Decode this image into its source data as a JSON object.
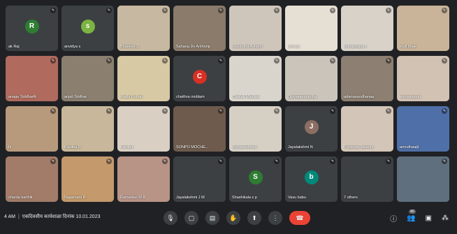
{
  "meeting": {
    "time": "4 AM",
    "title": "एकदिवसीय कार्यशाळा दिनांक 10.01.2023",
    "participants_badge": "40"
  },
  "tiles": [
    {
      "name": "ak Raj",
      "avatar": "R",
      "avatar_color": "#2e7d32",
      "bg": "#3c4043"
    },
    {
      "name": "anvidya s",
      "avatar": "s",
      "avatar_color": "#7cb342",
      "bg": "#3c4043"
    },
    {
      "name": "Bhavesh Ji",
      "avatar": "",
      "avatar_color": "",
      "bg": "#c7b8a1"
    },
    {
      "name": "Sahana Jiv Anthonp",
      "avatar": "",
      "avatar_color": "",
      "bg": "#8a7b6a"
    },
    {
      "name": "Vasundha Ashokh",
      "avatar": "",
      "avatar_color": "",
      "bg": "#cfc6bb"
    },
    {
      "name": "amruta",
      "avatar": "",
      "avatar_color": "",
      "bg": "#e6dfd4"
    },
    {
      "name": "soloaplolputh",
      "avatar": "",
      "avatar_color": "",
      "bg": "#d8d2c8"
    },
    {
      "name": "sruti bhak",
      "avatar": "",
      "avatar_color": "",
      "bg": "#c9b49a"
    },
    {
      "name": "anage Siddharth",
      "avatar": "",
      "avatar_color": "",
      "bg": "#b06a5e"
    },
    {
      "name": "anjali Sridhar",
      "avatar": "",
      "avatar_color": "",
      "bg": "#8b7f6f"
    },
    {
      "name": "Arathi Rohan",
      "avatar": "",
      "avatar_color": "",
      "bg": "#d8c9a5"
    },
    {
      "name": "chaithra moblam",
      "avatar": "C",
      "avatar_color": "#d93025",
      "bg": "#3c4043"
    },
    {
      "name": "Chaitali Manikar",
      "avatar": "",
      "avatar_color": "",
      "bg": "#d9d4cc"
    },
    {
      "name": "Divyaseemantha",
      "avatar": "",
      "avatar_color": "",
      "bg": "#cbc4ba"
    },
    {
      "name": "adamaraodhanaa",
      "avatar": "",
      "avatar_color": "",
      "bg": "#8d7f71"
    },
    {
      "name": "enmakasturi",
      "avatar": "",
      "avatar_color": "",
      "bg": "#d2c2b3"
    },
    {
      "name": "hi",
      "avatar": "",
      "avatar_color": "",
      "bg": "#b79a7c"
    },
    {
      "name": "Kavitha R",
      "avatar": "",
      "avatar_color": "",
      "bg": "#c8b79b"
    },
    {
      "name": "Kavitha",
      "avatar": "",
      "avatar_color": "",
      "bg": "#d9cfc3"
    },
    {
      "name": "SONPO MOCHE...",
      "avatar": "",
      "avatar_color": "",
      "bg": "#6e5b4d"
    },
    {
      "name": "Mahadeshwari",
      "avatar": "",
      "avatar_color": "",
      "bg": "#d6cfc4"
    },
    {
      "name": "Jayalakshmi N",
      "avatar": "J",
      "avatar_color": "#8d6e63",
      "bg": "#3c4043"
    },
    {
      "name": "Pravinda Jayanth",
      "avatar": "",
      "avatar_color": "",
      "bg": "#d3c5b8"
    },
    {
      "name": "amruthaajit",
      "avatar": "",
      "avatar_color": "",
      "bg": "#4f6fa8"
    },
    {
      "name": "sharda karthik",
      "avatar": "",
      "avatar_color": "",
      "bg": "#a27c69"
    },
    {
      "name": "Nagamani R",
      "avatar": "",
      "avatar_color": "",
      "bg": "#c49a6c"
    },
    {
      "name": "Ramadevi M R",
      "avatar": "",
      "avatar_color": "",
      "bg": "#b89486"
    },
    {
      "name": "Jayalakshmi J M",
      "avatar": "",
      "avatar_color": "",
      "bg": "#3c4043"
    },
    {
      "name": "Shashikala s p",
      "avatar": "S",
      "avatar_color": "#2e7d32",
      "bg": "#3c4043"
    },
    {
      "name": "Vasu babu",
      "avatar": "b",
      "avatar_color": "#00897b",
      "bg": "#3c4043"
    },
    {
      "name": "7 others",
      "avatar": "",
      "avatar_color": "",
      "bg": "#3c4043"
    },
    {
      "name": "",
      "avatar": "",
      "avatar_color": "",
      "bg": "#5f6f7d"
    }
  ]
}
